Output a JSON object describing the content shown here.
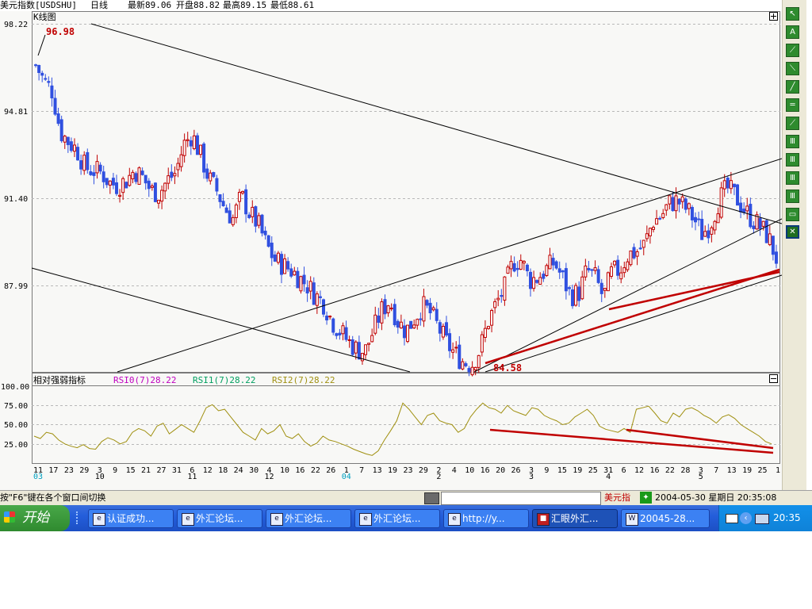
{
  "header": {
    "instrument": "美元指数[USDSHU]",
    "period": "日线",
    "latest": "最新89.06",
    "open": "开盘88.82",
    "high": "最高89.15",
    "low": "最低88.61"
  },
  "kline": {
    "panel_label": "K线图",
    "y_ticks": [
      "98.22",
      "94.81",
      "91.40",
      "87.99"
    ],
    "peak_label": "96.98",
    "trough_label": "84.58"
  },
  "rsi": {
    "panel_label": "相对强弱指标",
    "rsi0": "RSI0(7)28.22",
    "rsi1": "RSI1(7)28.22",
    "rsi2": "RSI2(7)28.22",
    "y_ticks": [
      "100.00",
      "75.00",
      "50.00",
      "25.00"
    ]
  },
  "x_axis": {
    "day_ticks": [
      "11",
      "17",
      "23",
      "29",
      "3",
      "9",
      "15",
      "21",
      "27",
      "31",
      "6",
      "12",
      "18",
      "24",
      "30",
      "4",
      "10",
      "16",
      "22",
      "26",
      "1",
      "7",
      "13",
      "19",
      "23",
      "29",
      "2",
      "4",
      "10",
      "16",
      "20",
      "26",
      "3",
      "9",
      "15",
      "19",
      "25",
      "31",
      "6",
      "12",
      "16",
      "22",
      "28",
      "3",
      "7",
      "13",
      "19",
      "25",
      "1"
    ],
    "month_ticks": [
      {
        "label": "03",
        "at": 0,
        "color": "#00a0c0"
      },
      {
        "label": "10",
        "at": 4,
        "color": "#000"
      },
      {
        "label": "11",
        "at": 10,
        "color": "#000"
      },
      {
        "label": "12",
        "at": 15,
        "color": "#000"
      },
      {
        "label": "04",
        "at": 20,
        "color": "#00a0c0"
      },
      {
        "label": "2",
        "at": 26,
        "color": "#000"
      },
      {
        "label": "3",
        "at": 32,
        "color": "#000"
      },
      {
        "label": "4",
        "at": 37,
        "color": "#000"
      },
      {
        "label": "5",
        "at": 43,
        "color": "#000"
      }
    ]
  },
  "toolbar": {
    "buttons": [
      "pointer-tool",
      "text-tool",
      "line-tool",
      "ray-tool",
      "segment-tool",
      "parallel-tool",
      "trend-tool",
      "grid-tool-a",
      "grid-tool-b",
      "grid-tool-c",
      "grid-tool-d",
      "ruler-tool",
      "delete-tool"
    ]
  },
  "status": {
    "tip": "按\"F6\"键在各个窗口间切换",
    "instrument": "美元指",
    "datetime": "2004-05-30 星期日 20:35:08"
  },
  "taskbar": {
    "start": "开始",
    "items": [
      {
        "label": "认证成功...",
        "icon": "ie-icon"
      },
      {
        "label": "外汇论坛...",
        "icon": "ie-icon"
      },
      {
        "label": "外汇论坛...",
        "icon": "ie-icon"
      },
      {
        "label": "外汇论坛...",
        "icon": "ie-icon"
      },
      {
        "label": "http://y...",
        "icon": "ie-icon"
      },
      {
        "label": "汇眼外汇...",
        "icon": "app-icon"
      },
      {
        "label": "20045-28...",
        "icon": "word-icon"
      }
    ],
    "clock": "20:35"
  },
  "colors": {
    "up_candle": "#c00000",
    "down_candle": "#3050e0",
    "rsi_line": "#a09010",
    "trendline_red": "#c00000",
    "channel_line": "#000000"
  },
  "chart_data": [
    {
      "type": "candlestick",
      "title": "K线图",
      "instrument": "美元指数[USDSHU]",
      "ylim": [
        84.58,
        98.22
      ],
      "y_ticks": [
        98.22,
        94.81,
        91.4,
        87.99
      ],
      "annotations": [
        {
          "label": "96.98",
          "value": 96.98
        },
        {
          "label": "84.58",
          "value": 84.58
        }
      ],
      "last": {
        "close": 89.06,
        "open": 88.82,
        "high": 89.15,
        "low": 88.61
      },
      "close_path": [
        96.6,
        96.0,
        95.6,
        94.0,
        93.6,
        93.3,
        92.6,
        92.5,
        92.4,
        92.0,
        91.9,
        92.1,
        92.5,
        92.2,
        91.7,
        91.6,
        92.1,
        92.4,
        93.5,
        93.9,
        93.1,
        92.2,
        91.7,
        91.0,
        90.6,
        91.5,
        90.8,
        90.4,
        89.6,
        89.0,
        88.8,
        88.6,
        88.3,
        88.0,
        87.6,
        87.3,
        86.6,
        86.2,
        85.8,
        85.5,
        85.4,
        86.2,
        87.0,
        87.4,
        86.6,
        86.2,
        86.7,
        87.2,
        86.9,
        86.3,
        85.7,
        85.3,
        85.0,
        84.9,
        85.5,
        86.6,
        87.3,
        87.9,
        88.9,
        89.0,
        88.2,
        88.3,
        88.6,
        88.9,
        88.3,
        87.6,
        87.7,
        88.6,
        88.3,
        87.5,
        88.5,
        88.6,
        89.2,
        89.3,
        89.6,
        90.5,
        90.7,
        91.2,
        91.3,
        91.0,
        90.6,
        90.0,
        90.4,
        91.3,
        91.8,
        91.5,
        91.0,
        90.6,
        90.3,
        89.9,
        89.06
      ]
    },
    {
      "type": "line",
      "title": "相对强弱指标",
      "series": [
        {
          "name": "RSI0(7)",
          "last": 28.22
        },
        {
          "name": "RSI1(7)",
          "last": 28.22
        },
        {
          "name": "RSI2(7)",
          "last": 28.22
        }
      ],
      "ylim": [
        0,
        100
      ],
      "y_ticks": [
        100,
        75,
        50,
        25
      ],
      "values": [
        35,
        32,
        40,
        38,
        30,
        25,
        22,
        20,
        24,
        19,
        18,
        28,
        33,
        30,
        25,
        28,
        40,
        45,
        42,
        35,
        48,
        52,
        38,
        44,
        50,
        45,
        40,
        55,
        72,
        76,
        68,
        70,
        60,
        50,
        40,
        35,
        30,
        45,
        38,
        42,
        50,
        35,
        32,
        38,
        28,
        22,
        26,
        35,
        30,
        28,
        25,
        22,
        18,
        15,
        12,
        10,
        16,
        30,
        42,
        55,
        78,
        70,
        60,
        50,
        62,
        65,
        55,
        52,
        50,
        40,
        45,
        60,
        70,
        78,
        72,
        70,
        65,
        75,
        68,
        65,
        62,
        72,
        70,
        62,
        58,
        55,
        50,
        52,
        60,
        65,
        70,
        62,
        48,
        44,
        42,
        40,
        45,
        40,
        70,
        72,
        74,
        65,
        55,
        52,
        65,
        60,
        70,
        72,
        68,
        62,
        58,
        52,
        60,
        63,
        58,
        50,
        45,
        40,
        35,
        28,
        25
      ]
    }
  ]
}
